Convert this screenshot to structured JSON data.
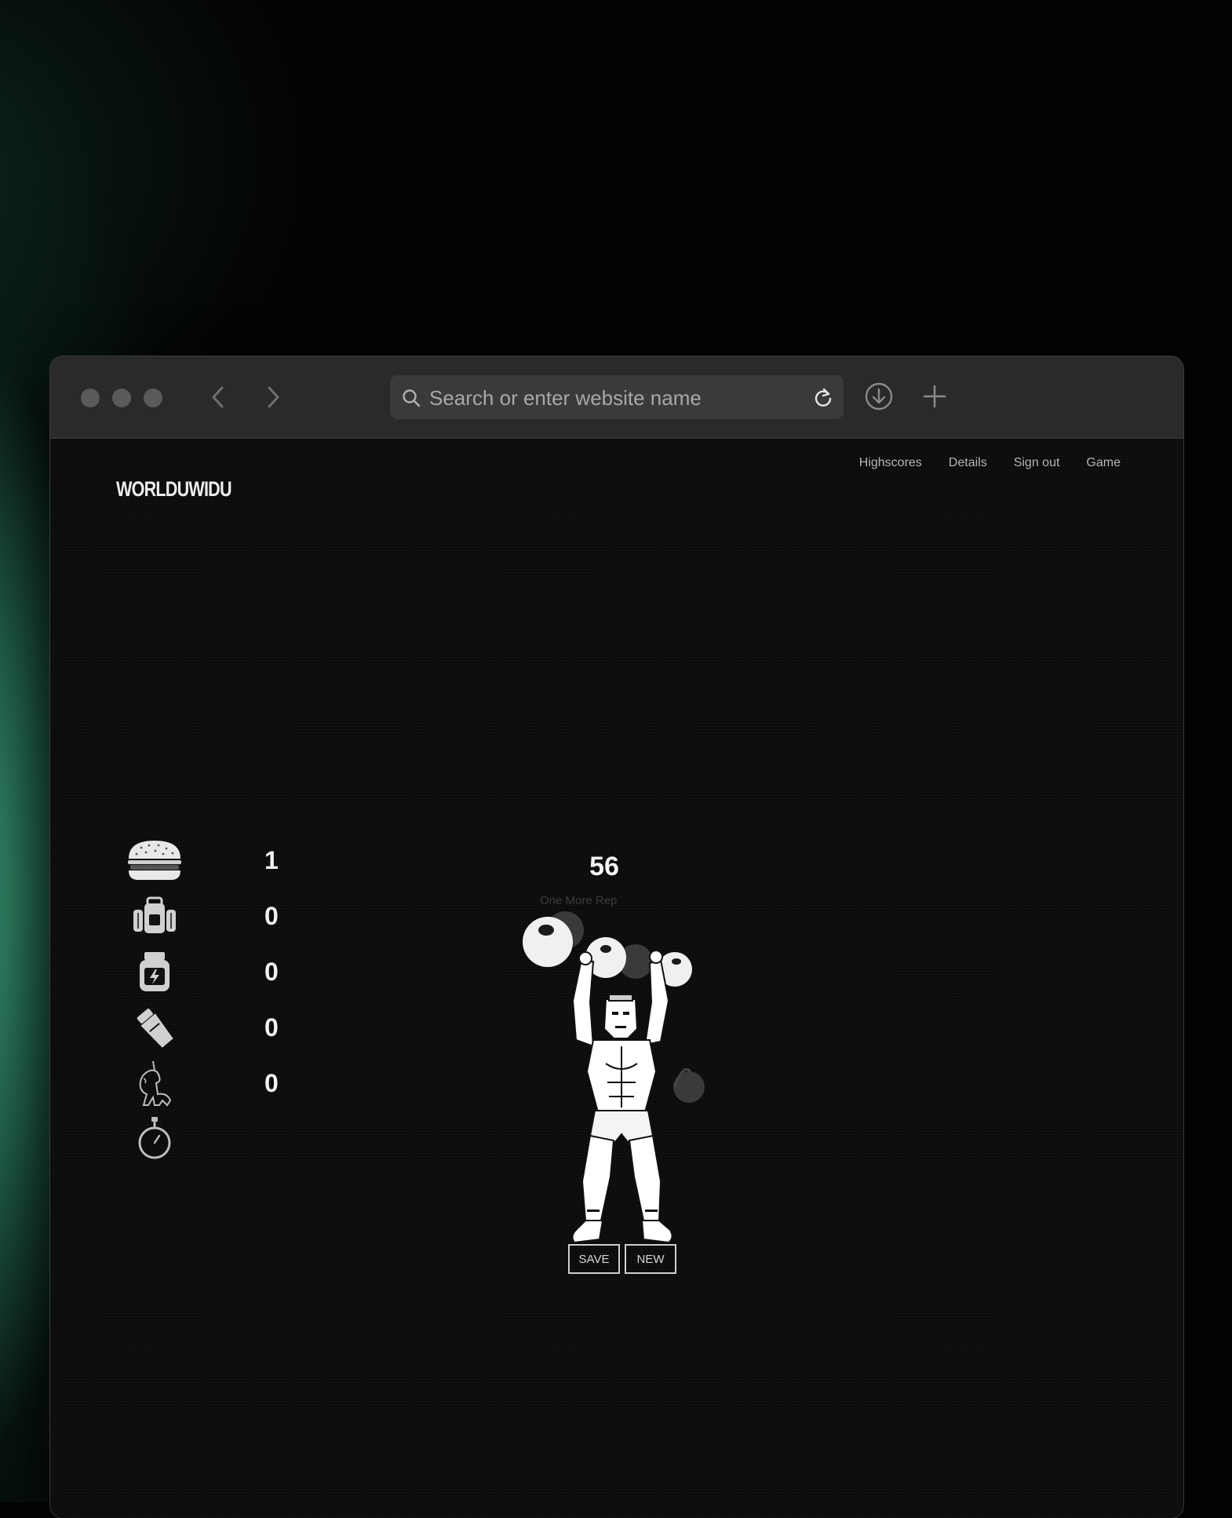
{
  "browser": {
    "address_bar": {
      "placeholder": "Search or enter website name",
      "value": ""
    },
    "icons": [
      "back-arrow-icon",
      "forward-arrow-icon",
      "search-icon",
      "reload-icon",
      "download-icon",
      "new-tab-icon"
    ]
  },
  "site": {
    "logo_text": "WORLDUWIDU",
    "nav": [
      "Highscores",
      "Details",
      "Sign out",
      "Game"
    ]
  },
  "stats": [
    {
      "icon": "burger-icon",
      "value": "1"
    },
    {
      "icon": "backpack-icon",
      "value": "0"
    },
    {
      "icon": "supplement-jar-icon",
      "value": "0"
    },
    {
      "icon": "shaker-bottle-icon",
      "value": "0"
    },
    {
      "icon": "unicorn-icon",
      "value": "0"
    },
    {
      "icon": "stopwatch-icon",
      "value": ""
    }
  ],
  "game": {
    "score": "56",
    "hint": "One More Rep",
    "buttons": {
      "save": "SAVE",
      "new": "NEW"
    }
  }
}
